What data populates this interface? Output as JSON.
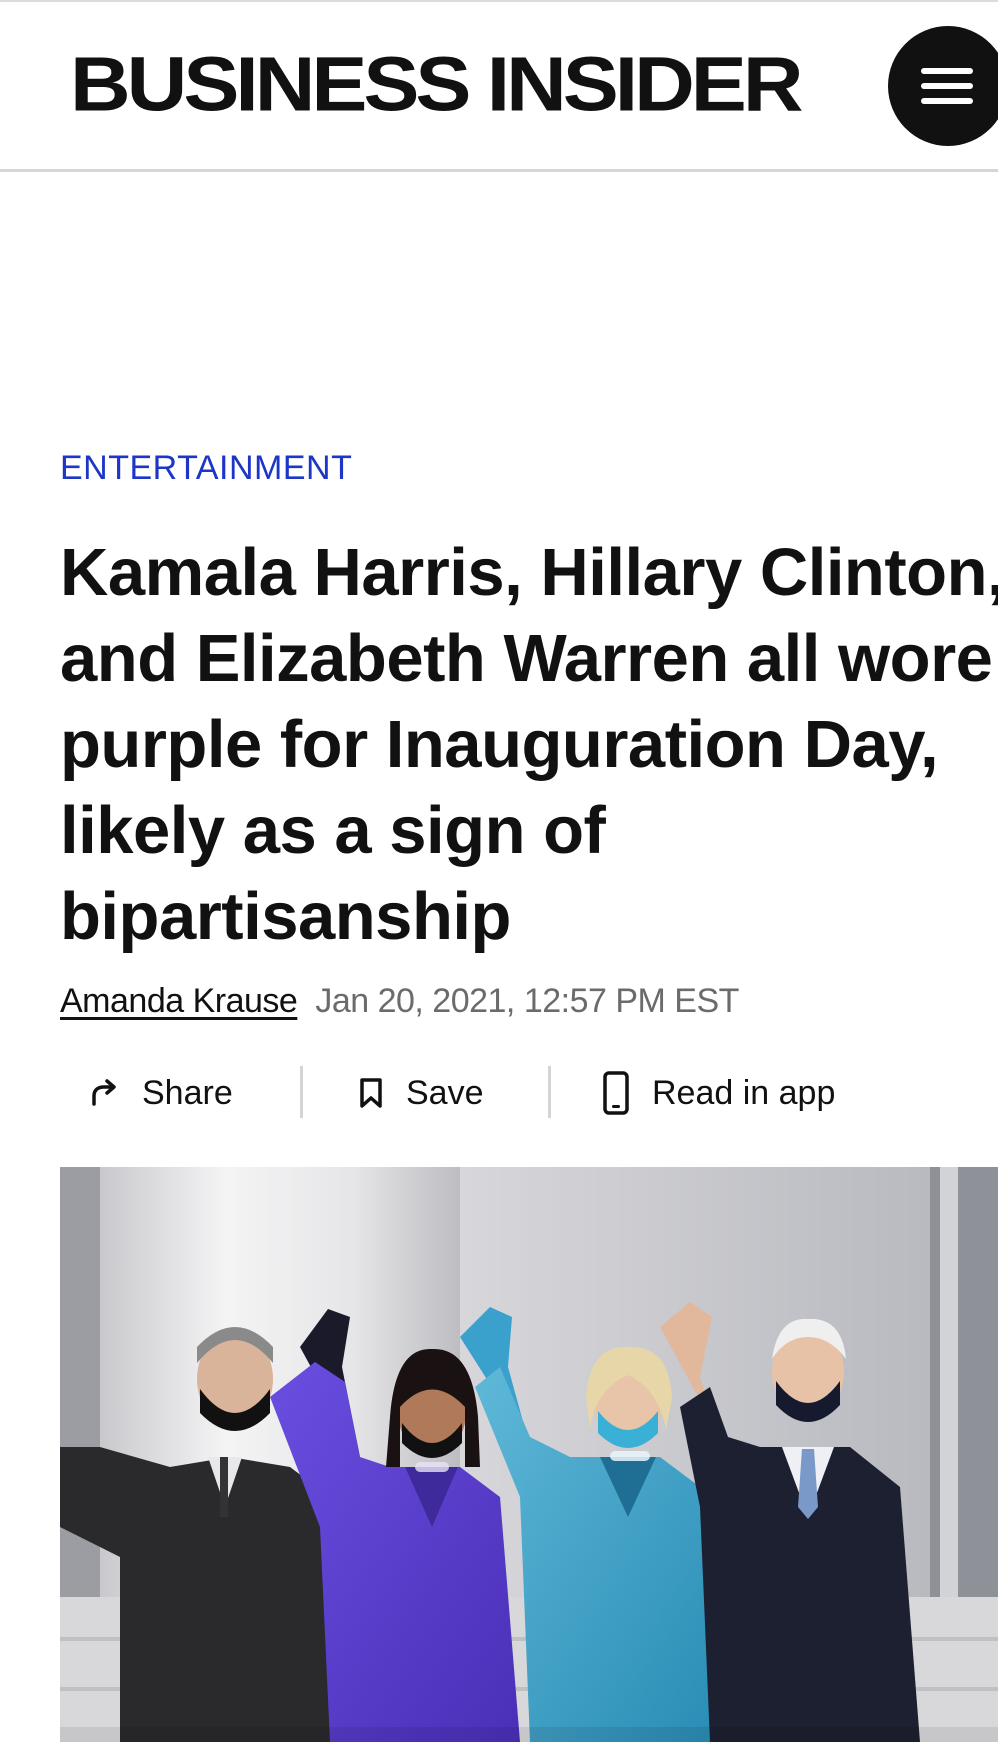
{
  "header": {
    "logo": "BUSINESS INSIDER",
    "menu_icon": "hamburger-menu-icon"
  },
  "article": {
    "category": "ENTERTAINMENT",
    "headline": "Kamala Harris, Hillary Clinton, and Elizabeth Warren all wore purple for Inauguration Day, likely as a sign of bipartisanship",
    "author": "Amanda Krause",
    "date": "Jan 20, 2021, 12:57 PM EST"
  },
  "actions": {
    "share_label": "Share",
    "share_icon": "share-arrow-icon",
    "save_label": "Save",
    "save_icon": "bookmark-icon",
    "read_in_app_label": "Read in app",
    "read_in_app_icon": "phone-icon"
  },
  "colors": {
    "category_blue": "#1d36c8",
    "text": "#111111",
    "date_gray": "#6b6b6b",
    "divider_gray": "#d4d4d4"
  }
}
